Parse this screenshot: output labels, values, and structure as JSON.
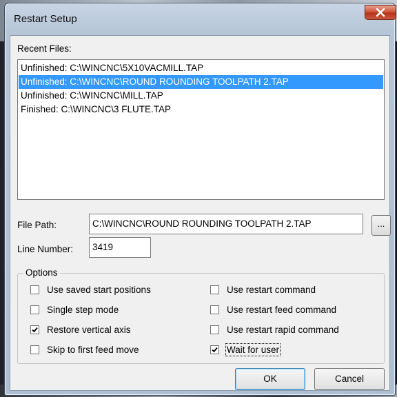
{
  "window": {
    "title": "Restart Setup"
  },
  "recent_files": {
    "label": "Recent Files:",
    "items": [
      "Unfinished: C:\\WINCNC\\5X10VACMILL.TAP",
      "Unfinished: C:\\WINCNC\\ROUND ROUNDING TOOLPATH 2.TAP",
      "Unfinished: C:\\WINCNC\\MILL.TAP",
      "Finished: C:\\WINCNC\\3 FLUTE.TAP"
    ],
    "selected_index": 1
  },
  "file_path": {
    "label": "File Path:",
    "value": "C:\\WINCNC\\ROUND ROUNDING TOOLPATH 2.TAP",
    "browse_label": "..."
  },
  "line_number": {
    "label": "Line Number:",
    "value": "3419"
  },
  "options": {
    "title": "Options",
    "left": [
      {
        "label": "Use saved start positions",
        "checked": false
      },
      {
        "label": "Single step mode",
        "checked": false
      },
      {
        "label": "Restore vertical axis",
        "checked": true
      },
      {
        "label": "Skip to first feed move",
        "checked": false
      }
    ],
    "right": [
      {
        "label": "Use restart command",
        "checked": false
      },
      {
        "label": "Use restart feed command",
        "checked": false
      },
      {
        "label": "Use restart rapid command",
        "checked": false
      },
      {
        "label": "Wait for user",
        "checked": true
      }
    ]
  },
  "buttons": {
    "ok": "OK",
    "cancel": "Cancel"
  },
  "colors": {
    "selection": "#3399ff",
    "close_button": "#c9452c"
  }
}
